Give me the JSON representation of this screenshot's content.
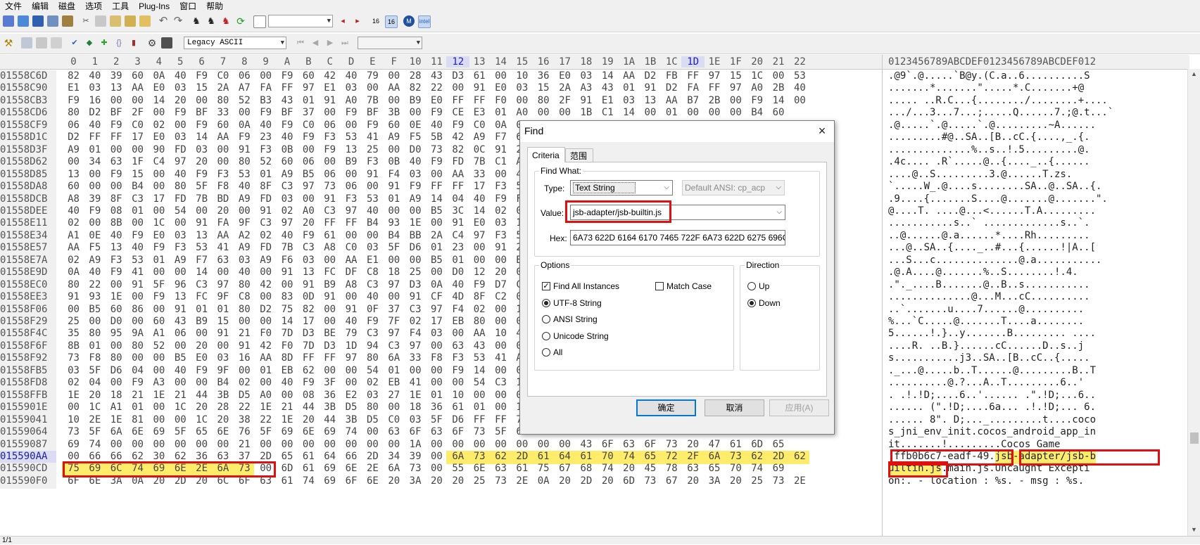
{
  "menu": [
    "文件",
    "编辑",
    "磁盘",
    "选项",
    "工具",
    "Plug-Ins",
    "窗口",
    "帮助"
  ],
  "toolbar": {
    "goto_value": "",
    "encoding": "Legacy ASCII",
    "nav_value": ""
  },
  "hex_view": {
    "col_headers": [
      "0",
      "1",
      "2",
      "3",
      "4",
      "5",
      "6",
      "7",
      "8",
      "9",
      "A",
      "B",
      "C",
      "D",
      "E",
      "F",
      "10",
      "11",
      "12",
      "13",
      "14",
      "15",
      "16",
      "17",
      "18",
      "19",
      "1A",
      "1B",
      "1C",
      "1D",
      "1E",
      "1F",
      "20",
      "21",
      "22"
    ],
    "ascii_header": "0123456789ABCDEF0123456789ABCDEF012",
    "rows": [
      {
        "addr": "01558C6D",
        "bytes": "82 40 39 60 0A 40 F9 C0 06 00 F9 60 42 40 79 00 28 43 D3 61 00 10 36 E0 03 14 AA D2 FB FF 97 15 1C 00 53",
        "ascii": ".@9`.@.....`B@y.(C.a..6..........S"
      },
      {
        "addr": "01558C90",
        "bytes": "E1 03 13 AA E0 03 15 2A A7 FA FF 97 E1 03 00 AA 82 22 00 91 E0 03 15 2A A3 43 01 91 D2 FA FF 97 A0 2B 40",
        "ascii": ".......*.......\".....*.C.......+@"
      },
      {
        "addr": "01558CB3",
        "bytes": "F9 16 00 00 14 20 00 80 52 B3 43 01 91 A0 7B 00 B9 E0 FF FF F0 00 80 2F 91 E1 03 13 AA B7 2B 00 F9 14 00",
        "ascii": "..... ..R.C...{......../........+...."
      },
      {
        "addr": "01558CD6",
        "bytes": "80 D2 BF 2F 00 F9 BF 33 00 F9 BF 37 00 F9 BF 3B 00 F9 CE E3 01 A0 00 00 1B C1 14 00 01 00 00 00 B4 60",
        "ascii": ".../...3...7...;.....Q......7.;@.t...`"
      },
      {
        "addr": "01558CF9",
        "bytes": "06 40 F9 C0 02 00 F9 60 0A 40 F9 C0 06 00 F9 60 0E 40 F9 C0 0A 00 F9 01 00 01 00 00 00 00 00 00 FF B5",
        "ascii": ".@.....`.@.....`.@.........~A......"
      },
      {
        "addr": "01558D1C",
        "bytes": "D2 FF FF 17 E0 03 14 AA F9 23 40 F9 F3 53 41 A9 F5 5B 42 A9 F7 63 43 A9 F9 6B 44 A9 FB 73 45 A9 7B BE",
        "ascii": ".........#@..SA..[B..cC.{....,_.{."
      },
      {
        "addr": "01558D3F",
        "bytes": "A9 01 00 00 90 FD 03 00 91 F3 0B 00 F9 13 25 00 D0 73 82 0C 91 21 00 32 91 E0 03 13 AA 01 00 00 00 00 40",
        "ascii": "..............%..s..!.5.........@."
      },
      {
        "addr": "01558D62",
        "bytes": "00 34 63 1F C4 97 20 00 80 52 60 06 00 B9 F3 0B 40 F9 FD 7B C1 A8 C0 03 5F D6 FD 7B BF A9 FD 03 00 7B 91",
        "ascii": ".4c.... .R`.....@..{...._..{......"
      },
      {
        "addr": "01558D85",
        "bytes": "13 00 F9 15 00 40 F9 F3 53 01 A9 B5 06 00 91 F4 03 00 AA 33 00 40 F9 B3 01 00 B4 E0 03 15 AA 54 00 73 F5",
        "ascii": "....@..S.........3.@......T.zs."
      },
      {
        "addr": "01558DA8",
        "bytes": "60 00 00 B4 00 80 5F F8 40 8F C3 97 73 06 00 91 F9 FF FF 17 F3 53 41 A9 F5 13 40 F9 FD 7B C3 A8 C0 7B C3",
        "ascii": "`.....W_.@....s........SA..@..SA..{."
      },
      {
        "addr": "01558DCB",
        "bytes": "A8 39 8F C3 17 FD 7B BD A9 FD 03 00 91 F3 53 01 A9 14 04 40 F9 F5 13 00 F9 15 00 40 F9 B5 01 00 F0 B4 CC",
        "ascii": ".9....{.......S....@.......@.......\"."
      },
      {
        "addr": "01558DEE",
        "bytes": "40 F9 08 01 00 54 00 20 00 91 02 A0 C3 97 40 00 00 B5 3C 14 02 00 54 0E 41 F8 A5 00 00 EB C1 FE 14 00",
        "ascii": "@....T. ....@...<......T.A........."
      },
      {
        "addr": "01558E11",
        "bytes": "02 00 8B 00 1C 00 91 FA 9F C3 97 20 FF FF B4 93 1E 00 91 E0 03 13 AA 08 9F C3 97 73 06 00 91 73 06 1F F8",
        "ascii": "...........s..` .............s..`."
      },
      {
        "addr": "01558E34",
        "bytes": "A1 0E 40 F9 E0 03 13 AA A2 02 40 F9 61 00 00 B4 BB 2A C4 97 F3 53 41 A9 F5 13 40 F9 FD 7B C3 A8 C0 03 13",
        "ascii": "..@......@.a......*....Rh........."
      },
      {
        "addr": "01558E57",
        "bytes": "AA F5 13 40 F9 F3 53 41 A9 FD 7B C3 A8 C0 03 5F D6 01 23 00 91 23 E3 01 00 A3 00 FF 81 11 41 00 00 F5 5B",
        "ascii": "...@..SA..{...._..#...{......!|A..["
      },
      {
        "addr": "01558E7A",
        "bytes": "02 A9 F3 53 01 A9 F7 63 03 A9 F6 03 00 AA E1 00 00 B5 01 00 00 B0 02 00 00 F0 B4 C0 00 00 00 F9 C0",
        "ascii": "...S...c..............@.a..........."
      },
      {
        "addr": "01558E9D",
        "bytes": "0A 40 F9 41 00 00 14 00 40 00 91 13 FC DF C8 18 25 00 D0 12 20 00 91 12 00 34 13 00 00 F9 13 34 91",
        "ascii": ".@.A....@.......%..S........!.4."
      },
      {
        "addr": "01558EC0",
        "bytes": "80 22 00 91 5F 96 C3 97 80 42 00 91 B9 A8 C3 97 D3 0A 40 F9 D7 C5 FA A0 C2 E9 F3 02 03 97 80 42 40 06",
        "ascii": ".\"._....B.......@..B..s..........."
      },
      {
        "addr": "01558EE3",
        "bytes": "91 93 1E 00 F9 13 FC 9F C8 00 83 0D 91 00 40 00 91 CF 4D 8F C2 04 93 63 43 00 00 F9 00 00 80 A3 80 01",
        "ascii": "..............@...M...cC.........."
      },
      {
        "addr": "01558F06",
        "bytes": "00 B5 60 86 00 91 01 01 80 D2 75 82 00 91 0F 37 C3 97 F4 02 00 10 1B F0 1A 2E 43 00 00 00 00 00 F9 00",
        "ascii": "..`.......u....7......@.........."
      },
      {
        "addr": "01558F29",
        "bytes": "25 00 D0 00 60 43 B9 15 00 00 14 17 00 40 F9 7F 02 17 EB 80 00 00 54 00 14 00 00 00 00 00 00 00 15 EB",
        "ascii": "%...`C.....@.......T....a........"
      },
      {
        "addr": "01558F4C",
        "bytes": "35 80 95 9A A1 06 00 91 21 F0 7D D3 BE 79 C3 97 F4 03 00 AA 10 42 1E 00 00 00 00 00 00 00 00 0C 17",
        "ascii": "5......!.}..y.......B......... ...."
      },
      {
        "addr": "01558F6F",
        "bytes": "8B 01 00 80 52 00 20 00 91 42 F0 7D D3 1D 94 C3 97 00 63 43 00 00 00 00 00 00 00 00 00 00 80 6A",
        "ascii": "....R. ..B.}......cC......D..s..j"
      },
      {
        "addr": "01558F92",
        "bytes": "73 F8 80 00 00 B5 E0 03 16 AA 8D FF FF 97 80 6A 33 F8 F3 53 41 A9 F5 5B 42 A9 F7 63 43 A9 FD 7B A8 C0",
        "ascii": "s...........j3..SA..[B..cC..{....."
      },
      {
        "addr": "01558FB5",
        "bytes": "03 5F D6 04 00 40 F9 9F 00 01 EB 62 00 00 54 01 00 00 F9 14 00 00 00 00 00 00 00 00 00 00 00 00 00 54",
        "ascii": "._...@.....b..T......@.........B..T"
      },
      {
        "addr": "01558FD8",
        "bytes": "02 04 00 F9 A3 00 00 B4 02 00 40 F9 3F 00 02 EB 41 00 00 54 C3 14 00 00 00 00 00 00 00 00 00 00 03 27",
        "ascii": "..........@.?...A..T.........6..'"
      },
      {
        "addr": "01558FFB",
        "bytes": "1E 20 18 21 1E 21 44 3B D5 A0 00 08 36 E2 03 27 1E 01 10 00 00 00 00 00 00 00 00 00 00 00 00 E2 01",
        "ascii": ". .!.!D;....6..'...... .\".!D;...6.."
      },
      {
        "addr": "0155901E",
        "bytes": "00 1C A1 01 00 1C 20 28 22 1E 21 44 3B D5 80 00 18 36 61 01 00 1C 20 08 21 1E 21 44 3B D5 A0 00 20 36 02",
        "ascii": "...... (\".!D;....6a... .!.!D;... 6."
      },
      {
        "addr": "01559041",
        "bytes": "10 2E 1E 81 00 00 1C 20 38 22 1E 20 44 3B D5 C0 03 5F D6 FF FF 7F 7F AE C5 9D 74 00 00 80 00 63 6F 63 6F",
        "ascii": "...... 8\". D;..._.........t....coco"
      },
      {
        "addr": "01559064",
        "bytes": "73 5F 6A 6E 69 5F 65 6E 76 5F 69 6E 69 74 00 63 6F 63 6F 73 5F 61 6E 64 72 6F 69 64 5F 61 70 70 5F 69 6E",
        "ascii": "s_jni_env_init.cocos_android_app_in"
      },
      {
        "addr": "01559087",
        "bytes": "69 74 00 00 00 00 00 00 21 00 00 00 00 00 00 00 1A 00 00 00 00 00 00 00 43 6F 63 6F 73 20 47 61 6D 65",
        "ascii": "it.......!.........Cocos Game"
      },
      {
        "addr": "015590AA",
        "bytes": "00 66 66 62 30 62 36 63 37 2D 65 61 64 66 2D 34 39 00 6A 73 62 2D 61 64 61 70 74 65 72 2F 6A 73 62 2D 62",
        "ascii": ".ffb0b6c7-eadf-49.jsb-adapter/jsb-b"
      },
      {
        "addr": "015590CD",
        "bytes": "75 69 6C 74 69 6E 2E 6A 73 00 6D 61 69 6E 2E 6A 73 00 55 6E 63 61 75 67 68 74 20 45 78 63 65 70 74 69",
        "ascii": "uiltin.js.main.js.Uncaught Excepti"
      },
      {
        "addr": "015590F0",
        "bytes": "6F 6E 3A 0A 20 2D 20 6C 6F 63 61 74 69 6F 6E 20 3A 20 20 25 73 2E 0A 20 2D 20 6D 73 67 20 3A 20 25 73 2E",
        "ascii": "on:. - location :  %s. - msg : %s."
      }
    ]
  },
  "status": "1/1",
  "find_dialog": {
    "title": "Find",
    "close_glyph": "×",
    "tab_criteria": "Criteria",
    "tab_range": "范围",
    "find_what_label": "Find What:",
    "type_label": "Type:",
    "type_value": "Text String",
    "charset_value": "Default ANSI: cp_acp",
    "value_label": "Value:",
    "value_value": "jsb-adapter/jsb-builtin.js",
    "hex_label": "Hex:",
    "hex_value": "6A73 622D 6164 6170 7465 722F 6A73 622D 6275 696C",
    "options_label": "Options",
    "find_all_label": "Find All Instances",
    "match_case_label": "Match Case",
    "utf8_label": "UTF-8 String",
    "ansi_label": "ANSI String",
    "unicode_label": "Unicode String",
    "all_label": "All",
    "direction_label": "Direction",
    "up_label": "Up",
    "down_label": "Down",
    "ok_label": "确定",
    "cancel_label": "取消",
    "apply_label": "应用(A)"
  }
}
